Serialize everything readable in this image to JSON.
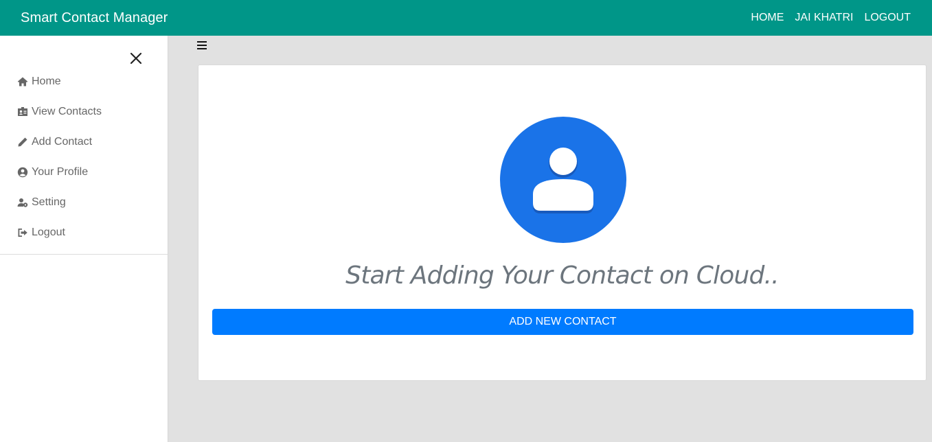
{
  "navbar": {
    "brand": "Smart Contact Manager",
    "links": [
      "HOME",
      "JAI KHATRI",
      "LOGOUT"
    ]
  },
  "sidebar": {
    "close_icon": "close-icon",
    "items": [
      {
        "label": "Home",
        "icon": "home-icon"
      },
      {
        "label": "View Contacts",
        "icon": "address-card-icon"
      },
      {
        "label": "Add Contact",
        "icon": "pencil-icon"
      },
      {
        "label": "Your Profile",
        "icon": "user-circle-icon"
      },
      {
        "label": "Setting",
        "icon": "user-gear-icon"
      },
      {
        "label": "Logout",
        "icon": "sign-out-icon"
      }
    ]
  },
  "main": {
    "menu_icon": "hamburger-icon",
    "avatar_icon": "contact-avatar-icon",
    "tagline": "Start Adding Your Contact on Cloud..",
    "add_button": "ADD NEW CONTACT"
  },
  "colors": {
    "navbar": "#009688",
    "primary_button": "#007bff",
    "avatar_blue": "#1a73e8",
    "page_background": "#e1e1e1"
  }
}
